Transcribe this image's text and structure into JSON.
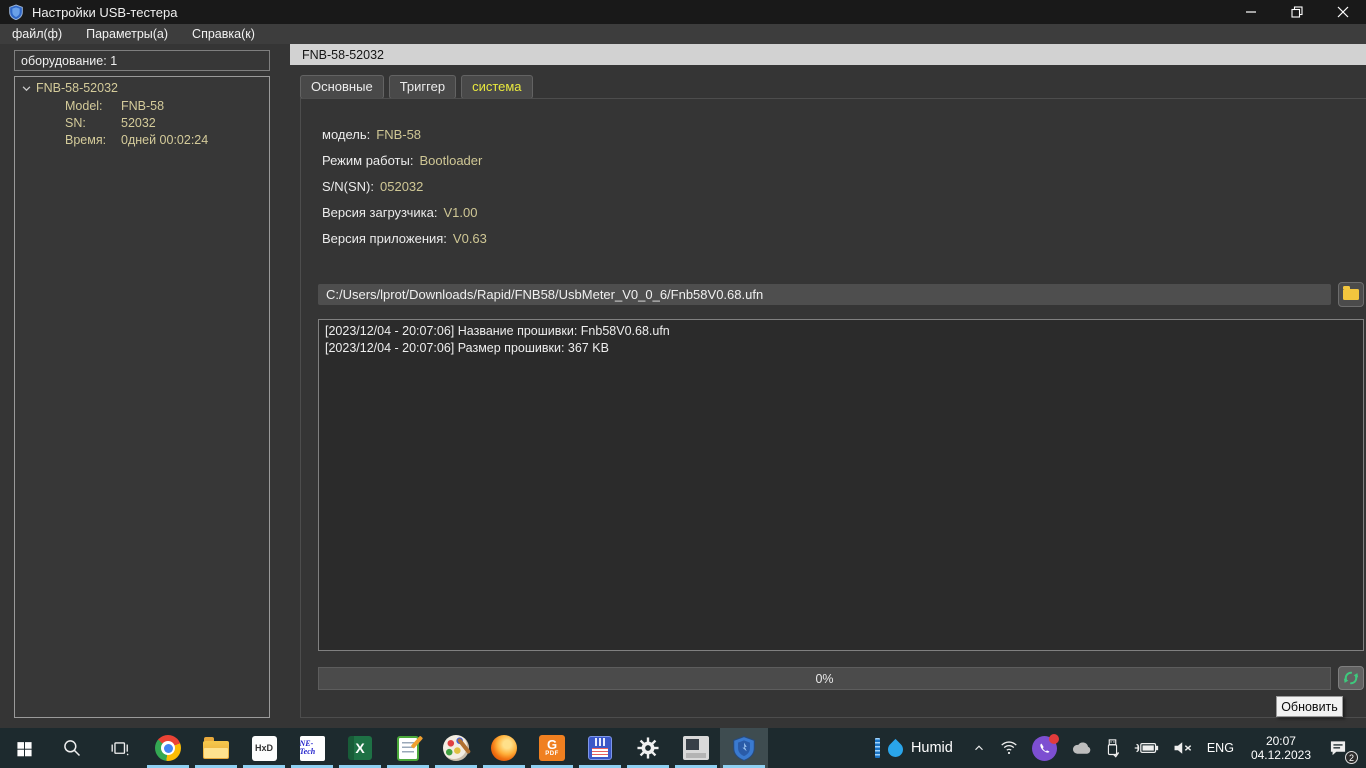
{
  "window": {
    "title": "Настройки USB-тестера",
    "menu": [
      "файл(ф)",
      "Параметры(а)",
      "Справка(к)"
    ]
  },
  "sidebar": {
    "header": "оборудование: 1",
    "device": {
      "name": "FNB-58-52032",
      "rows": [
        {
          "label": "Model:",
          "value": "FNB-58"
        },
        {
          "label": "SN:",
          "value": "52032"
        },
        {
          "label": "Время:",
          "value": "0дней 00:02:24"
        }
      ]
    }
  },
  "main": {
    "header": "FNB-58-52032",
    "tabs": [
      {
        "label": "Основные"
      },
      {
        "label": "Триггер"
      },
      {
        "label": "система"
      }
    ],
    "fields": [
      {
        "label": "модель:",
        "value": "FNB-58"
      },
      {
        "label": "Режим работы:",
        "value": "Bootloader"
      },
      {
        "label": "S/N(SN):",
        "value": "052032"
      },
      {
        "label": "Версия загрузчика:",
        "value": "V1.00"
      },
      {
        "label": "Версия приложения:",
        "value": "V0.63"
      }
    ],
    "firmware_path": "C:/Users/lprot/Downloads/Rapid/FNB58/UsbMeter_V0_0_6/Fnb58V0.68.ufn",
    "log": [
      "[2023/12/04 - 20:07:06] Название прошивки: Fnb58V0.68.ufn",
      "[2023/12/04 - 20:07:06] Размер прошивки: 367 KB"
    ],
    "progress_label": "0%",
    "refresh_tooltip": "Обновить"
  },
  "taskbar": {
    "apps": [
      {
        "name": "start"
      },
      {
        "name": "search"
      },
      {
        "name": "task-view"
      },
      {
        "name": "chrome"
      },
      {
        "name": "file-explorer"
      },
      {
        "name": "hxd",
        "glyph": "HxD"
      },
      {
        "name": "ne-tech",
        "glyph": "NE-Tech"
      },
      {
        "name": "excel",
        "glyph": "X"
      },
      {
        "name": "notepad"
      },
      {
        "name": "paint"
      },
      {
        "name": "firefox"
      },
      {
        "name": "pdf-reader",
        "glyph": "G",
        "label": "PDF"
      },
      {
        "name": "total-commander"
      },
      {
        "name": "settings"
      },
      {
        "name": "emulator"
      },
      {
        "name": "usb-tester"
      }
    ],
    "tray": {
      "widget_label": "Humid",
      "language": "ENG",
      "time": "20:07",
      "date": "04.12.2023",
      "notification_count": "2"
    }
  },
  "colors": {
    "value_text": "#cfc795",
    "active_tab_text": "#e9e93e",
    "taskbar_bg": "#1d2a2e",
    "running_underline": "#8fd0f2",
    "refresh_icon": "#3ec97d",
    "header_bar": "#d2d2d2"
  }
}
